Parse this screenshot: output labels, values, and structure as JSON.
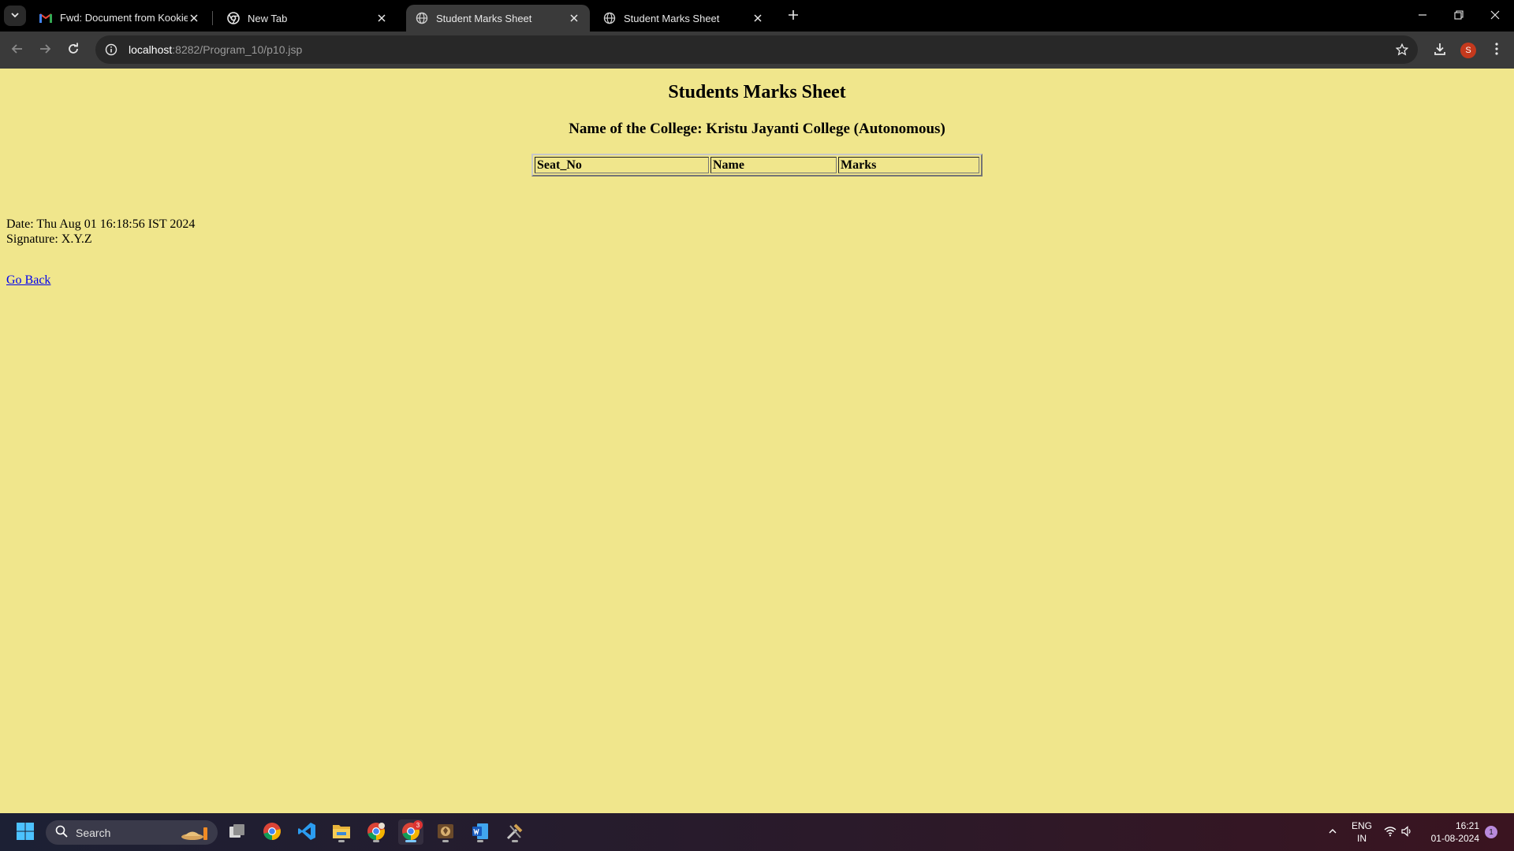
{
  "browser": {
    "tabs": [
      {
        "title": "Fwd: Document from Kookie❤️",
        "icon": "gmail-icon",
        "active": false
      },
      {
        "title": "New Tab",
        "icon": "chrome-icon",
        "active": false
      },
      {
        "title": "Student Marks Sheet",
        "icon": "globe-icon",
        "active": true
      },
      {
        "title": "Student Marks Sheet",
        "icon": "globe-icon",
        "active": false
      }
    ],
    "url_host": "localhost",
    "url_path": ":8282/Program_10/p10.jsp",
    "profile_initial": "S"
  },
  "page": {
    "heading": "Students Marks Sheet",
    "college": "Name of the College: Kristu Jayanti College (Autonomous)",
    "table_headers": [
      "Seat_No",
      "Name",
      "Marks"
    ],
    "date_line": "Date: Thu Aug 01 16:18:56 IST 2024",
    "signature_line": "Signature: X.Y.Z",
    "back_link": "Go Back",
    "background_color": "#f0e68c"
  },
  "taskbar": {
    "search_label": "Search",
    "chrome_badge": "3",
    "lang_top": "ENG",
    "lang_bottom": "IN",
    "time": "16:21",
    "date": "01-08-2024",
    "notification_count": "1"
  }
}
